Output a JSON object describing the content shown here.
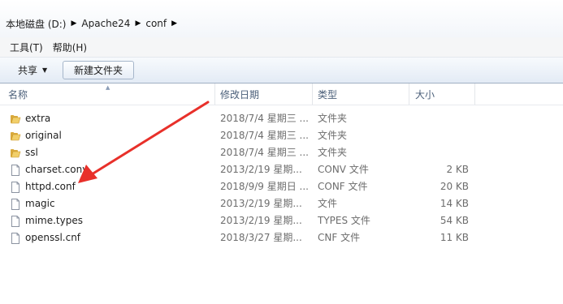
{
  "breadcrumb": [
    "本地磁盘 (D:)",
    "Apache24",
    "conf"
  ],
  "menu": [
    "工具(T)",
    "帮助(H)"
  ],
  "toolbar": {
    "share": "共享",
    "new_folder": "新建文件夹"
  },
  "columns": {
    "name": "名称",
    "date": "修改日期",
    "type": "类型",
    "size": "大小"
  },
  "files": [
    {
      "name": "extra",
      "date": "2018/7/4 星期三 ...",
      "type": "文件夹",
      "size": "",
      "icon": "folder-icon"
    },
    {
      "name": "original",
      "date": "2018/7/4 星期三 ...",
      "type": "文件夹",
      "size": "",
      "icon": "folder-icon"
    },
    {
      "name": "ssl",
      "date": "2018/7/4 星期三 ...",
      "type": "文件夹",
      "size": "",
      "icon": "folder-icon"
    },
    {
      "name": "charset.conv",
      "date": "2013/2/19 星期...",
      "type": "CONV 文件",
      "size": "2 KB",
      "icon": "file-icon"
    },
    {
      "name": "httpd.conf",
      "date": "2018/9/9 星期日 ...",
      "type": "CONF 文件",
      "size": "20 KB",
      "icon": "file-icon"
    },
    {
      "name": "magic",
      "date": "2013/2/19 星期...",
      "type": "文件",
      "size": "14 KB",
      "icon": "file-icon"
    },
    {
      "name": "mime.types",
      "date": "2013/2/19 星期...",
      "type": "TYPES 文件",
      "size": "54 KB",
      "icon": "file-icon"
    },
    {
      "name": "openssl.cnf",
      "date": "2018/3/27 星期...",
      "type": "CNF 文件",
      "size": "11 KB",
      "icon": "file-icon"
    }
  ],
  "colors": {
    "annotation": "#e8302a",
    "folder": "#e8c15a",
    "header_text": "#4c607a"
  }
}
